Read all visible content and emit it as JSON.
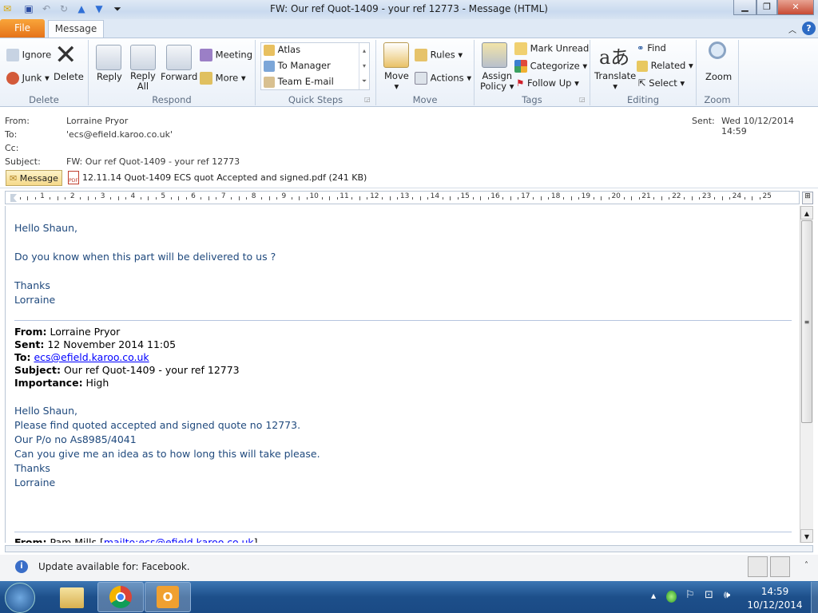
{
  "window": {
    "title": "FW: Our ref Quot-1409 - your ref 12773  - Message (HTML)"
  },
  "tabs": {
    "file": "File",
    "message": "Message"
  },
  "ribbon": {
    "delete": {
      "label": "Delete",
      "ignore": "Ignore",
      "junk": "Junk",
      "delete": "Delete"
    },
    "respond": {
      "label": "Respond",
      "reply": "Reply",
      "reply_all_1": "Reply",
      "reply_all_2": "All",
      "forward": "Forward",
      "meeting": "Meeting",
      "more": "More"
    },
    "quick_steps": {
      "label": "Quick Steps",
      "items": [
        "Atlas",
        "To Manager",
        "Team E-mail"
      ]
    },
    "move": {
      "label": "Move",
      "move": "Move",
      "rules": "Rules",
      "actions": "Actions"
    },
    "tags": {
      "label": "Tags",
      "assign_1": "Assign",
      "assign_2": "Policy",
      "mark_unread": "Mark Unread",
      "categorize": "Categorize",
      "follow_up": "Follow Up"
    },
    "editing": {
      "label": "Editing",
      "translate": "Translate",
      "find": "Find",
      "related": "Related",
      "select": "Select"
    },
    "zoom": {
      "label": "Zoom",
      "zoom": "Zoom"
    }
  },
  "header": {
    "from_label": "From:",
    "from": "Lorraine Pryor",
    "to_label": "To:",
    "to": "'ecs@efield.karoo.co.uk'",
    "cc_label": "Cc:",
    "subject_label": "Subject:",
    "subject": "FW: Our ref Quot-1409 - your ref 12773",
    "sent_label": "Sent:",
    "sent": "Wed 10/12/2014 14:59"
  },
  "attachments": {
    "message": "Message",
    "file": "12.11.14 Quot-1409 ECS quot Accepted and signed.pdf (241 KB)"
  },
  "ruler_numbers": [
    "1",
    "2",
    "3",
    "4",
    "5",
    "6",
    "7",
    "8",
    "9",
    "10",
    "11",
    "12",
    "13",
    "14",
    "15",
    "16",
    "17",
    "18",
    "19",
    "20",
    "21",
    "22",
    "23",
    "24",
    "25"
  ],
  "body": {
    "l1": "Hello Shaun,",
    "l2": "Do you know when this part  will be delivered to us ?",
    "l3": "Thanks",
    "l4": "Lorraine",
    "fwd": {
      "from_label": "From:",
      "from": " Lorraine Pryor",
      "sent_label": "Sent:",
      "sent": " 12 November 2014 11:05",
      "to_label": "To:",
      "to": "ecs@efield.karoo.co.uk",
      "subject_label": "Subject:",
      "subject": " Our ref Quot-1409 - your ref 12773",
      "importance_label": "Importance:",
      "importance": " High"
    },
    "m1": "Hello Shaun,",
    "m2": "Please find quoted accepted and signed quote no 12773.",
    "m3": "Our P/o no As8985/4041",
    "m4": "Can you give me an idea as to how long this will take please.",
    "m5": "Thanks",
    "m6": "Lorraine",
    "fwd2_label": "From:",
    "fwd2_from": " Pam Mills [",
    "fwd2_link": "mailto:ecs@efield.karoo.co.uk",
    "fwd2_end": "]"
  },
  "infobar": {
    "text": "Update available for: Facebook."
  },
  "taskbar": {
    "time": "14:59",
    "date": "10/12/2014"
  },
  "colors": {
    "body_text": "#1f497d",
    "file_tab": "#e5731a",
    "link": "#0000ff"
  }
}
